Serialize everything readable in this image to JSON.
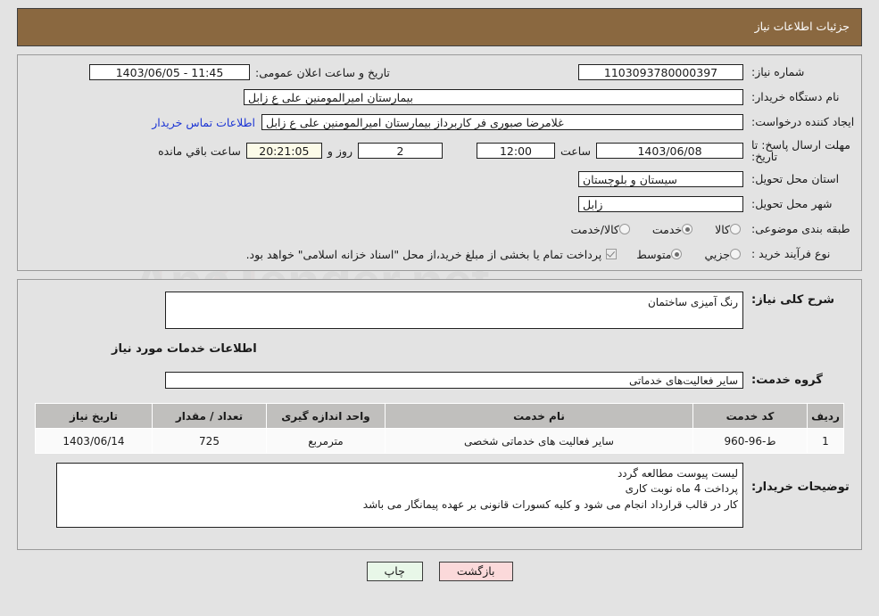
{
  "header": {
    "title": "جزئیات اطلاعات نیاز"
  },
  "fields": {
    "need_number": {
      "label": "شماره نیاز:",
      "value": "1103093780000397"
    },
    "public_announce": {
      "label": "تاریخ و ساعت اعلان عمومی:",
      "value": "11:45 - 1403/06/05"
    },
    "buyer_org": {
      "label": "نام دستگاه خریدار:",
      "value": "بیمارستان امیرالمومنین علی  ع  زابل"
    },
    "requester": {
      "label": "ایجاد کننده درخواست:",
      "value": "غلامرضا صبوری فر کاربرداز بیمارستان امیرالمومنین علی  ع  زابل"
    },
    "contact_link": "اطلاعات تماس خریدار",
    "deadline": {
      "label": "مهلت ارسال پاسخ: تا تاریخ:",
      "value": "1403/06/08"
    },
    "deadline_time": {
      "label": "ساعت",
      "value": "12:00"
    },
    "days_remaining": {
      "value": "2",
      "label": "روز و"
    },
    "time_remaining": {
      "value": "20:21:05",
      "label": "ساعت باقي مانده"
    },
    "province": {
      "label": "استان محل تحویل:",
      "value": "سیستان و بلوچستان"
    },
    "city": {
      "label": "شهر محل تحویل:",
      "value": "زابل"
    },
    "category": {
      "label": "طبقه بندی موضوعی:"
    },
    "process_type": {
      "label": "نوع فرآیند خرید :"
    }
  },
  "category_options": [
    {
      "label": "کالا",
      "selected": false
    },
    {
      "label": "خدمت",
      "selected": true
    },
    {
      "label": "کالا/خدمت",
      "selected": false
    }
  ],
  "process_options": [
    {
      "label": "جزیي",
      "selected": false
    },
    {
      "label": "متوسط",
      "selected": true
    }
  ],
  "treasury": {
    "checked": true,
    "text": "پرداخت تمام یا بخشی از مبلغ خرید،از محل \"اسناد خزانه اسلامی\" خواهد بود."
  },
  "descriptions": {
    "general_label": "شرح کلی نیاز:",
    "general_value": "رنگ آمیزی ساختمان",
    "services_section_title": "اطلاعات خدمات مورد نیاز",
    "service_group_label": "گروه خدمت:",
    "service_group_value": "سایر فعالیت‌های خدماتی",
    "buyer_notes_label": "توضیحات خریدار:",
    "buyer_notes_value": "لیست پیوست مطالعه گردد\nپرداخت 4 ماه نوبت کاری\nکار در قالب قرارداد انجام می شود و کلیه کسورات قانونی بر عهده پیمانگار می باشد"
  },
  "table": {
    "headers": [
      "ردیف",
      "کد خدمت",
      "نام خدمت",
      "واحد اندازه گیری",
      "تعداد / مقدار",
      "تاریخ نیاز"
    ],
    "rows": [
      {
        "index": "1",
        "code": "ط-96-960",
        "name": "سایر فعالیت های خدماتی شخصی",
        "unit": "مترمربع",
        "quantity": "725",
        "date": "1403/06/14"
      }
    ]
  },
  "buttons": {
    "print": "چاپ",
    "back": "بازگشت"
  },
  "colors": {
    "header_bar": "#8a6840",
    "page_bg": "#e3e3e3",
    "link": "#1c35d4",
    "back_btn": "#fbd9da",
    "print_btn": "#e8f7e8",
    "table_header": "#c0bfbd"
  },
  "watermark": {
    "text": "AnaTender.net"
  }
}
